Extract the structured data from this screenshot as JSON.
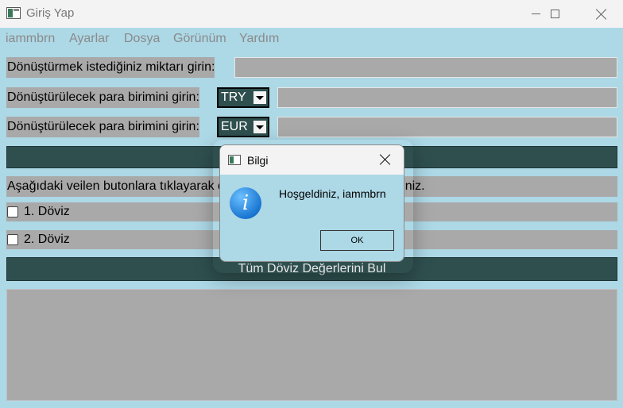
{
  "window": {
    "title": "Giriş Yap",
    "icons": {
      "app": "app-window-icon",
      "minimize": "minimize-icon",
      "maximize": "maximize-icon",
      "close": "close-icon"
    }
  },
  "menu": {
    "items": [
      "iammbrn",
      "Ayarlar",
      "Dosya",
      "Görünüm",
      "Yardım"
    ]
  },
  "form": {
    "amount_label": "Dönüştürmek istediğiniz miktarı girin:",
    "amount_value": "",
    "from_label": "Dönüştürülecek para birimini girin:",
    "from_currency": "TRY",
    "from_value": "",
    "to_label": "Dönüştürülecek para birimini girin:",
    "to_currency": "EUR",
    "to_value": "",
    "convert_button_label": "",
    "info_text": "Aşağıdaki veilen butonlara tıklayarak dövizlere karşı değerini bulabilirsiniz.",
    "currency_checks": [
      "1. Döviz",
      "2. Döviz"
    ],
    "find_all_button": "Tüm Döviz Değerlerini Bul",
    "output_text": ""
  },
  "dialog": {
    "title": "Bilgi",
    "message": "Hoşgeldiniz, iammbrn",
    "ok_label": "OK",
    "icon": "information-icon"
  },
  "colors": {
    "background": "#add8e6",
    "field": "#a9a9a9",
    "button": "#2f4f4f",
    "titlebar": "#f3f3f3"
  }
}
